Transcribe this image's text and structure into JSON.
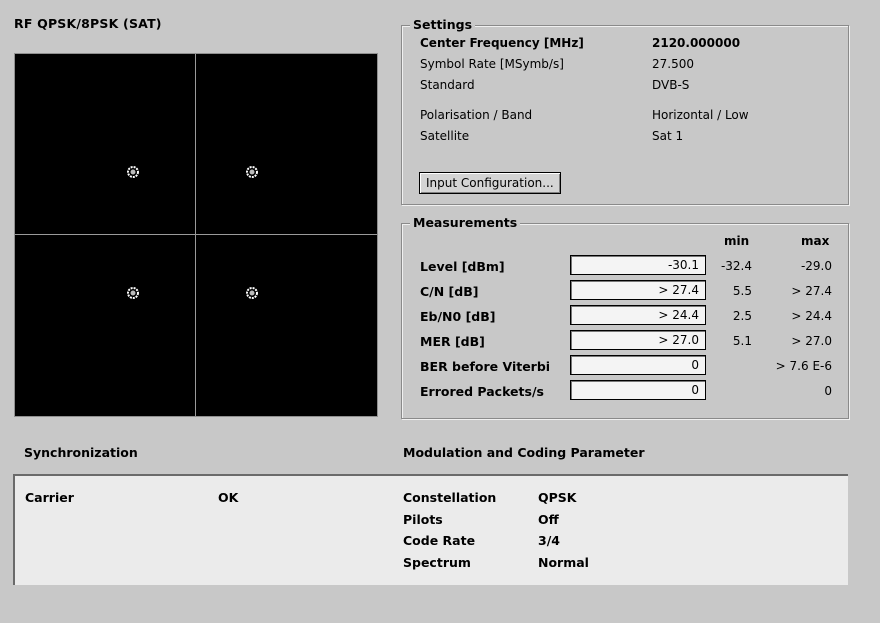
{
  "title": "RF QPSK/8PSK (SAT)",
  "settings": {
    "title": "Settings",
    "rows": [
      {
        "label": "Center Frequency [MHz]",
        "value": "2120.000000"
      },
      {
        "label": "Symbol Rate [MSymb/s]",
        "value": "27.500"
      },
      {
        "label": "Standard",
        "value": "DVB-S"
      },
      {
        "label": "Polarisation / Band",
        "value": "Horizontal / Low"
      },
      {
        "label": "Satellite",
        "value": "Sat 1"
      }
    ],
    "input_config_label": "Input Configuration..."
  },
  "measurements": {
    "title": "Measurements",
    "header_min": "min",
    "header_max": "max",
    "rows": [
      {
        "label": "Level [dBm]",
        "value": "-30.1",
        "min": "-32.4",
        "max": "-29.0"
      },
      {
        "label": "C/N [dB]",
        "value": "> 27.4",
        "min": "5.5",
        "max": "> 27.4"
      },
      {
        "label": "Eb/N0 [dB]",
        "value": "> 24.4",
        "min": "2.5",
        "max": "> 24.4"
      },
      {
        "label": "MER [dB]",
        "value": "> 27.0",
        "min": "5.1",
        "max": "> 27.0"
      },
      {
        "label": "BER before Viterbi",
        "value": "0",
        "min": "",
        "max": "> 7.6 E-6"
      },
      {
        "label": "Errored Packets/s",
        "value": "0",
        "min": "",
        "max": "0"
      }
    ]
  },
  "synchronization": {
    "heading": "Synchronization",
    "carrier_label": "Carrier",
    "carrier_status": "OK"
  },
  "modulation": {
    "heading": "Modulation and Coding Parameter",
    "rows": [
      {
        "label": "Constellation",
        "value": "QPSK"
      },
      {
        "label": "Pilots",
        "value": "Off"
      },
      {
        "label": "Code Rate",
        "value": "3/4"
      },
      {
        "label": "Spectrum",
        "value": "Normal"
      }
    ]
  },
  "colors": {
    "background": "#c8c8c8",
    "display_background": "#000000",
    "constellation_points": "#ffffff",
    "panel": "#ebebeb"
  }
}
